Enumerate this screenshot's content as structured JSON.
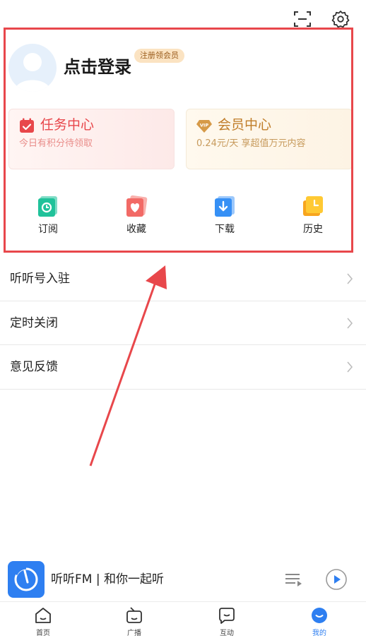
{
  "profile": {
    "login_text": "点击登录",
    "register_badge": "注册领会员"
  },
  "cards": {
    "task": {
      "title": "任务中心",
      "subtitle": "今日有积分待领取",
      "icon": "calendar-check-icon"
    },
    "vip": {
      "title": "会员中心",
      "subtitle": "0.24元/天 享超值万元内容",
      "icon": "vip-diamond-icon"
    }
  },
  "quick_actions": [
    {
      "label": "订阅",
      "icon": "subscribe-icon"
    },
    {
      "label": "收藏",
      "icon": "favorite-heart-icon"
    },
    {
      "label": "下载",
      "icon": "download-icon"
    },
    {
      "label": "历史",
      "icon": "history-clock-icon"
    }
  ],
  "menu": [
    {
      "label": "听听号入驻"
    },
    {
      "label": "定时关闭"
    },
    {
      "label": "意见反馈"
    }
  ],
  "player": {
    "title": "听听FM | 和你一起听"
  },
  "tabs": [
    {
      "label": "首页",
      "icon": "home-icon"
    },
    {
      "label": "广播",
      "icon": "radio-icon"
    },
    {
      "label": "互动",
      "icon": "chat-icon"
    },
    {
      "label": "我的",
      "icon": "profile-icon"
    }
  ],
  "colors": {
    "accent": "#2e7ff1",
    "task_red": "#e8474b",
    "vip_gold": "#c07d29",
    "highlight": "#e8474b"
  }
}
